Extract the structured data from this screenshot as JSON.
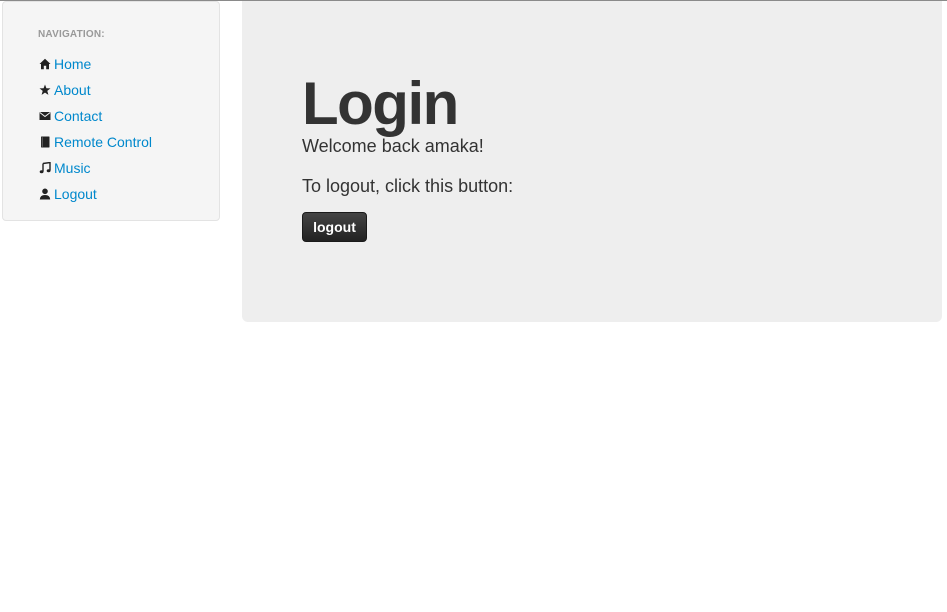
{
  "sidebar": {
    "header": "NAVIGATION:",
    "items": [
      {
        "label": "Home",
        "icon": "home-icon"
      },
      {
        "label": "About",
        "icon": "star-icon"
      },
      {
        "label": "Contact",
        "icon": "envelope-icon"
      },
      {
        "label": "Remote Control",
        "icon": "book-icon"
      },
      {
        "label": "Music",
        "icon": "music-note-icon"
      },
      {
        "label": "Logout",
        "icon": "user-icon"
      }
    ]
  },
  "main": {
    "title": "Login",
    "welcome": "Welcome back amaka!",
    "instruction": "To logout, click this button:",
    "logout_button": "logout"
  },
  "colors": {
    "link": "#0088cc",
    "hero_background": "#eeeeee",
    "sidebar_background": "#f5f5f5",
    "button": "#222222"
  }
}
